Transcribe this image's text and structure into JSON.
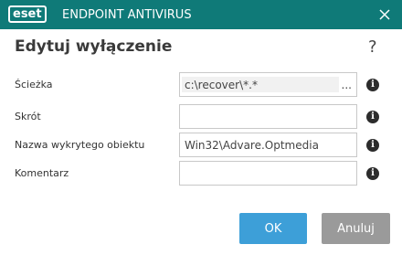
{
  "titlebar": {
    "brand": "eset",
    "product": "ENDPOINT ANTIVIRUS"
  },
  "dialog": {
    "title": "Edytuj wyłączenie",
    "help": "?"
  },
  "fields": {
    "path": {
      "label": "Ścieżka",
      "value": "c:\\recover\\*.*",
      "browse": "..."
    },
    "hash": {
      "label": "Skrót",
      "value": ""
    },
    "threat_name": {
      "label": "Nazwa wykrytego obiektu",
      "value": "Win32\\Advare.Optmedia"
    },
    "comment": {
      "label": "Komentarz",
      "value": ""
    }
  },
  "info_glyph": "i",
  "buttons": {
    "ok": "OK",
    "cancel": "Anuluj"
  },
  "colors": {
    "titlebar": "#0f7a78",
    "ok_button": "#3d9fd8",
    "cancel_button": "#9a9a9a"
  }
}
